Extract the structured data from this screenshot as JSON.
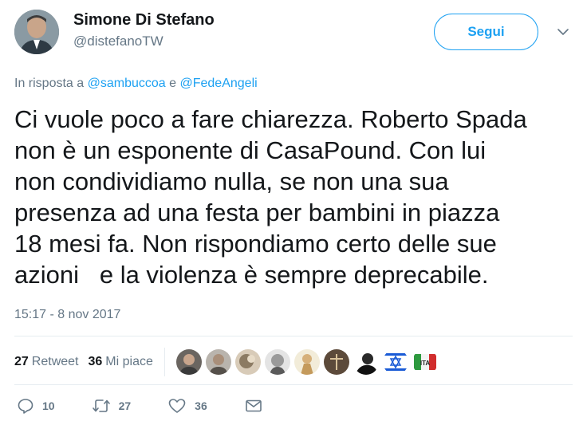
{
  "user": {
    "name": "Simone Di Stefano",
    "handle": "@distefanoTW"
  },
  "follow_label": "Segui",
  "reply": {
    "prefix": "In risposta a",
    "mention1": "@sambuccoa",
    "conj": "e",
    "mention2": "@FedeAngeli"
  },
  "tweet_text": "Ci vuole poco a fare chiarezza. Roberto Spada\nnon è un esponente di CasaPound. Con lui\nnon condividiamo nulla, se non una sua\npresenza ad una festa per bambini in piazza\n18 mesi fa. Non rispondiamo certo delle sue\nazioni   e la violenza è sempre deprecabile.",
  "timestamp": "15:17 - 8 nov 2017",
  "stats": {
    "retweets": "27",
    "retweets_label": "Retweet",
    "likes": "36",
    "likes_label": "Mi piace"
  },
  "actions": {
    "replies": "10",
    "retweets": "27",
    "likes": "36"
  },
  "colors": {
    "accent": "#1da1f2",
    "secondary_text": "#657786",
    "primary_text": "#14171a",
    "divider": "#e6ecf0"
  }
}
